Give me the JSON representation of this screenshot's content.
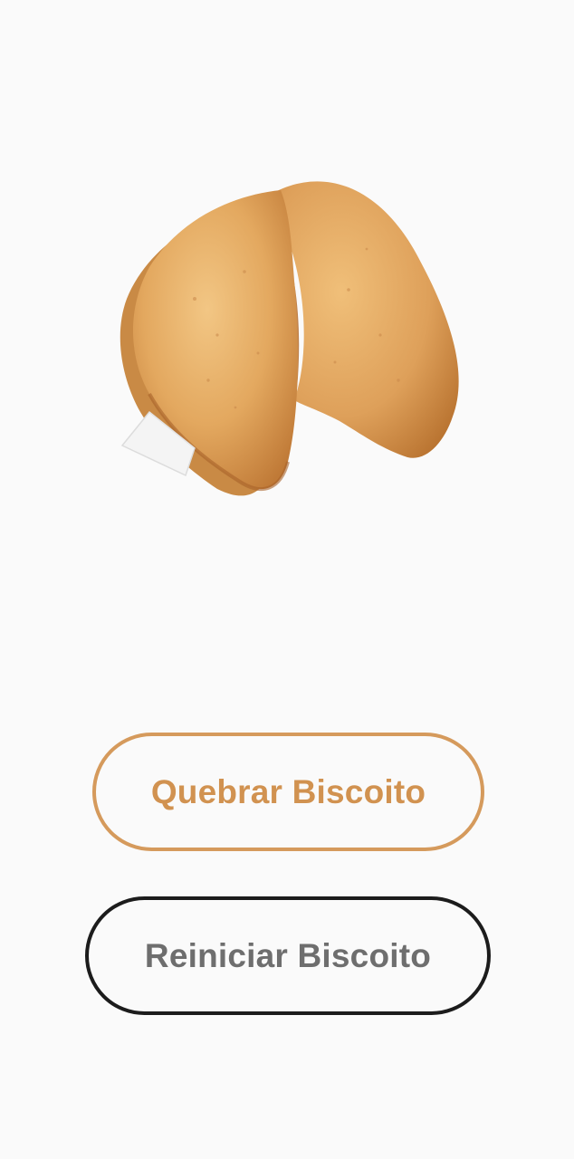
{
  "app": {
    "image": {
      "icon": "fortune-cookie-image",
      "colors": {
        "cookie_light": "#f0c27f",
        "cookie_mid": "#dfa35c",
        "cookie_dark": "#b97434",
        "paper": "#f4f4f4"
      }
    },
    "buttons": {
      "break_label": "Quebrar Biscoito",
      "reset_label": "Reiniciar Biscoito"
    },
    "colors": {
      "background": "#fafafa",
      "break_accent": "#d59a5c",
      "reset_border": "#1c1c1c",
      "reset_text": "#6e6e6e"
    }
  }
}
